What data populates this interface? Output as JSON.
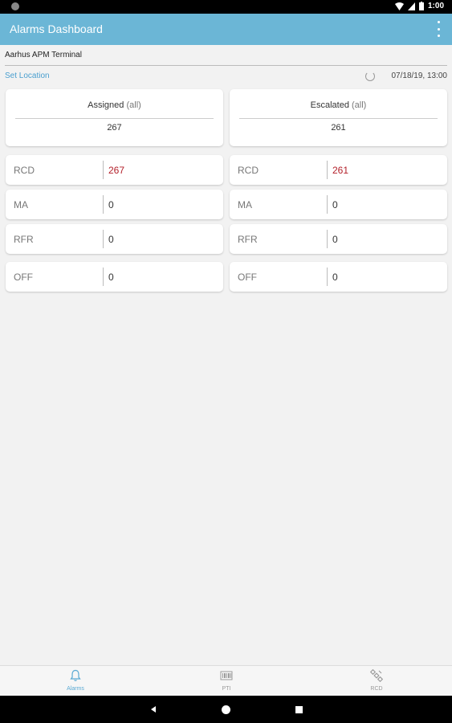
{
  "status_bar": {
    "time": "1:00"
  },
  "app_bar": {
    "title": "Alarms Dashboard"
  },
  "terminal": {
    "name": "Aarhus APM Terminal"
  },
  "location": {
    "set_label": "Set Location",
    "timestamp": "07/18/19, 13:00"
  },
  "assigned": {
    "title": "Assigned",
    "filter": "(all)",
    "total": "267",
    "rows": [
      {
        "label": "RCD",
        "value": "267"
      },
      {
        "label": "MA",
        "value": "0"
      },
      {
        "label": "RFR",
        "value": "0"
      },
      {
        "label": "OFF",
        "value": "0"
      }
    ]
  },
  "escalated": {
    "title": "Escalated",
    "filter": "(all)",
    "total": "261",
    "rows": [
      {
        "label": "RCD",
        "value": "261"
      },
      {
        "label": "MA",
        "value": "0"
      },
      {
        "label": "RFR",
        "value": "0"
      },
      {
        "label": "OFF",
        "value": "0"
      }
    ]
  },
  "bottom_nav": {
    "items": [
      {
        "label": "Alarms",
        "icon": "bell-icon"
      },
      {
        "label": "PTI",
        "icon": "barcode-icon"
      },
      {
        "label": "RCD",
        "icon": "satellite-icon"
      }
    ]
  },
  "colors": {
    "accent": "#6bb6d6",
    "alert": "#b3202a",
    "link": "#4a9fcf"
  }
}
